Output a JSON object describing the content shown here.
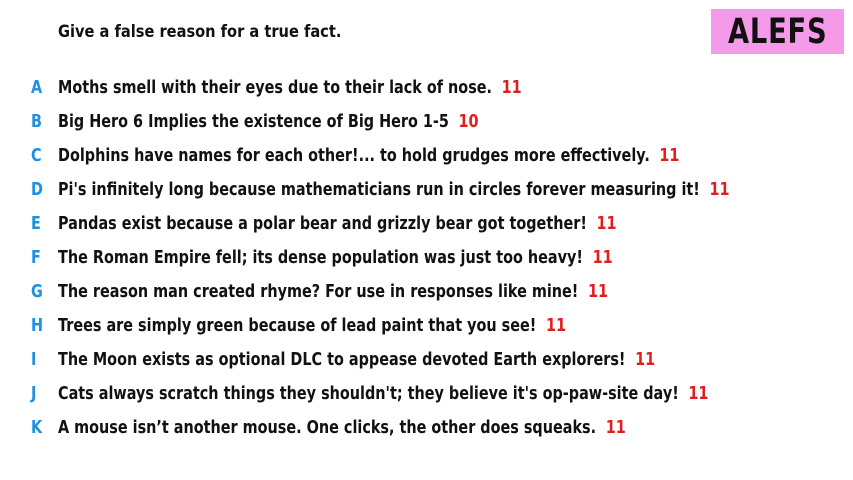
{
  "prompt": "Give a false reason for a true fact.",
  "logo": "ALEFS",
  "colors": {
    "logo_bg": "#f59ae8",
    "letter": "#1e90e0",
    "score": "#e01e1e"
  },
  "items": [
    {
      "letter": "A",
      "text": "Moths smell with their eyes due to their lack of nose.",
      "score": "11"
    },
    {
      "letter": "B",
      "text": "Big Hero 6 Implies the existence of Big Hero 1-5",
      "score": "10"
    },
    {
      "letter": "C",
      "text": "Dolphins have names for each other!... to hold grudges more effectively.",
      "score": "11"
    },
    {
      "letter": "D",
      "text": "Pi's infinitely long because mathematicians run in circles forever measuring it!",
      "score": "11"
    },
    {
      "letter": "E",
      "text": "Pandas exist because a polar bear and grizzly bear got together!",
      "score": "11"
    },
    {
      "letter": "F",
      "text": "The Roman Empire fell; its dense population was just too heavy!",
      "score": "11"
    },
    {
      "letter": "G",
      "text": "The reason man created rhyme? For use in responses like mine!",
      "score": "11"
    },
    {
      "letter": "H",
      "text": "Trees are simply green because of lead paint that you see!",
      "score": "11"
    },
    {
      "letter": "I",
      "text": "The Moon exists as optional DLC to appease devoted Earth explorers!",
      "score": "11"
    },
    {
      "letter": "J",
      "text": "Cats always scratch things they shouldn't; they believe it's op-paw-site day!",
      "score": "11"
    },
    {
      "letter": "K",
      "text": "A mouse isn’t another mouse. One clicks, the other does squeaks.",
      "score": "11"
    }
  ]
}
